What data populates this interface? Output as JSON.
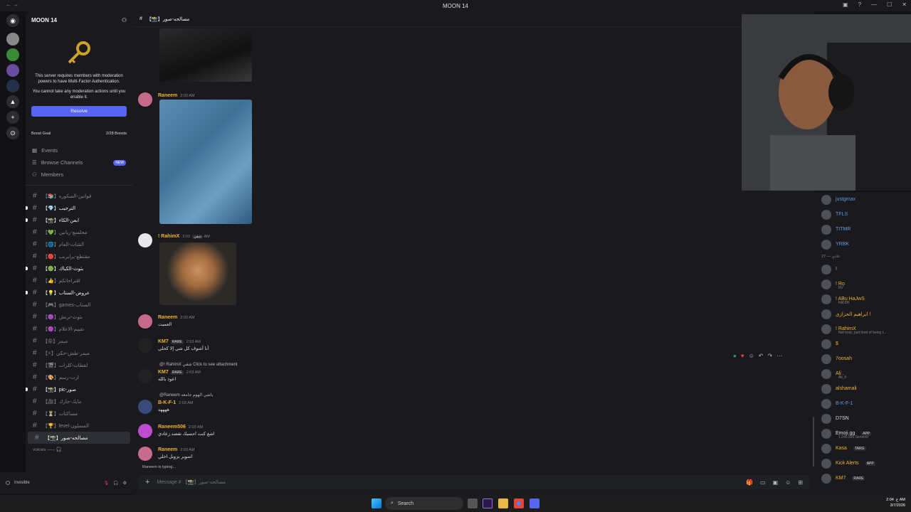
{
  "window": {
    "title": "MOON 14"
  },
  "server": {
    "name": "MOON 14"
  },
  "mfa": {
    "line1": "This server requires members with moderation powers to have Multi-Factor Authentication.",
    "line2": "You cannot take any moderation actions until you enable it.",
    "resolve": "Resolve"
  },
  "boost": {
    "label": "Boost Goal",
    "count": "2/28 Boosts"
  },
  "nav": [
    {
      "label": "Events"
    },
    {
      "label": "Browse Channels",
      "badge": "NEW"
    },
    {
      "label": "Members"
    }
  ],
  "channels": [
    {
      "label": "【📚】قوانين-السكوره",
      "unread": false
    },
    {
      "label": "【💎】الترحيب",
      "unread": true
    },
    {
      "label": "【📸】ابعن-الكاء",
      "unread": true
    },
    {
      "label": "【💚】مجلسع-ريانين",
      "unread": false
    },
    {
      "label": "【🌐】الشات-العام",
      "unread": false
    },
    {
      "label": "【🔴】مقتطع-برابرنب",
      "unread": false
    },
    {
      "label": "【🟢】بثوث-الكباك",
      "unread": true
    },
    {
      "label": "【👍】اقتراحاتكم",
      "unread": false
    },
    {
      "label": "【💡】عروض-الستاب",
      "unread": true
    },
    {
      "label": "【🎮】games-الستاب",
      "unread": false
    },
    {
      "label": "【🟣】بثوث-ترنش",
      "unread": false
    },
    {
      "label": "【🟣】تقييم-الاعلام",
      "unread": false
    },
    {
      "label": "【😡】ميمز",
      "unread": false
    },
    {
      "label": "【⚡】ميمز-طش-حكي",
      "unread": false
    },
    {
      "label": "【🎬】لقطات-كلرات",
      "unread": false
    },
    {
      "label": "【🎨】ارت-رسم",
      "unread": false
    },
    {
      "label": "【📸】pic-صور",
      "unread": true
    },
    {
      "label": "【🎥】مايك-جازك",
      "unread": false
    },
    {
      "label": "【⏳】مساكنات",
      "unread": false
    },
    {
      "label": "【🏆】level-المسلون",
      "unread": false
    },
    {
      "label": "【📸】مصالحه-صور",
      "unread": false,
      "active": true
    }
  ],
  "voices": "voices ⸺ 🎧",
  "user": {
    "status": "Invisible"
  },
  "channel_header": {
    "name": "【📸】مصالحه-صور"
  },
  "messages": [
    {
      "user": "Raneem",
      "time": "2:03 AM",
      "color": "#f0b232"
    },
    {
      "user": "! RahimX",
      "time": "2:03 AM",
      "tag": "شقي",
      "color": "#f0b232"
    },
    {
      "user": "Raneem",
      "time": "2:03 AM",
      "text": "العميت",
      "color": "#f0b232"
    },
    {
      "user": "KM7",
      "time": "2:03 AM",
      "tag": "RARE",
      "text": "أنا أشوف كل شي إلا كحلي",
      "color": "#f0b232"
    },
    {
      "reply": "@! RahimX شقي Click to see attachment",
      "user": "KM7",
      "time": "2:03 AM",
      "tag": "RARE",
      "text": "اعوذ بالله",
      "color": "#f0b232"
    },
    {
      "reply": "@Raneem ياشي الهوم جامعه",
      "user": "B-K-F-1",
      "time": "2:03 AM",
      "text": "ههههه",
      "color": "#f0b232"
    },
    {
      "user": "Raneem506",
      "time": "2:03 AM",
      "text": "اشغ كنت احسبك تقصد زعادي",
      "color": "#f0b232"
    },
    {
      "user": "Raneem",
      "time": "2:03 AM",
      "text": "اسوير بزوبل اخلي",
      "color": "#f0b232"
    }
  ],
  "typing": "Raneem is typing...",
  "composer": {
    "placeholder": "Message # 【📸】مصالحه-صور"
  },
  "members": [
    {
      "name": "justgmax",
      "color": "#5e9ddb"
    },
    {
      "name": "TFLS",
      "color": "#5e9ddb"
    },
    {
      "name": "TITMR",
      "color": "#5e9ddb"
    },
    {
      "name": "YRBK",
      "color": "#5e9ddb"
    }
  ],
  "member_group": "عادي — 27",
  "members2": [
    {
      "name": "!",
      "color": "#f0b232"
    },
    {
      "name": "! Ro",
      "sub": "RV",
      "color": "#f0b232"
    },
    {
      "name": "! ABu HaJwS",
      "sub": "NIKSH",
      "color": "#f0b232"
    },
    {
      "name": "ابراهيم الحزازي !",
      "color": "#f0b232"
    },
    {
      "name": "! RahimX",
      "sub": "Not toxic, just tired of being t...",
      "color": "#f0b232"
    },
    {
      "name": "$",
      "color": "#f0b232"
    },
    {
      "name": "7oosah",
      "color": "#f0b232"
    },
    {
      "name": "Ali .",
      "sub": "Ali_fi",
      "color": "#f0b232"
    },
    {
      "name": "alshamali",
      "color": "#f0b232"
    },
    {
      "name": "B-K-F-1",
      "color": "#5e9ddb"
    },
    {
      "name": "D7SN",
      "color": "#dbdee1"
    },
    {
      "name": "Emoji.gg",
      "sub": "1,240,500 Servers!",
      "tag": "APP",
      "color": "#dbdee1"
    },
    {
      "name": "Kasa",
      "tag": "TARG",
      "color": "#f0b232"
    },
    {
      "name": "Kick Alerts",
      "tag": "APP",
      "color": "#f0b232"
    },
    {
      "name": "KM7",
      "tag": "RARE",
      "color": "#f0b232"
    }
  ],
  "taskbar": {
    "search": "Search",
    "time": "2:04 AM",
    "date": "3/7/2026",
    "lang": "ع"
  }
}
